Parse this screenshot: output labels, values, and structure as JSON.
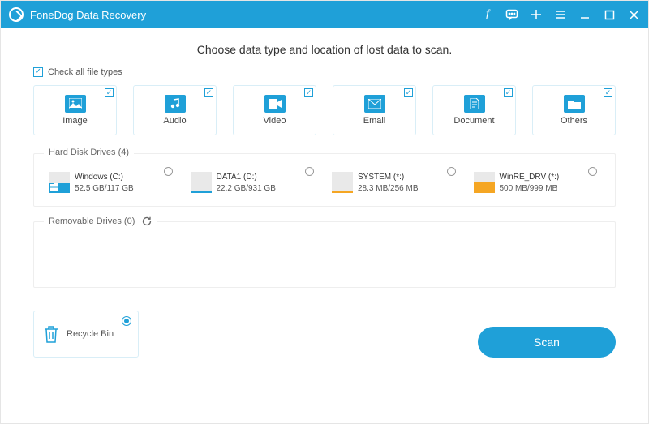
{
  "titlebar": {
    "title": "FoneDog Data Recovery"
  },
  "headline": "Choose data type and location of lost data to scan.",
  "check_all_label": "Check all file types",
  "types": [
    {
      "label": "Image"
    },
    {
      "label": "Audio"
    },
    {
      "label": "Video"
    },
    {
      "label": "Email"
    },
    {
      "label": "Document"
    },
    {
      "label": "Others"
    }
  ],
  "hdd_section": {
    "legend": "Hard Disk Drives (4)",
    "drives": [
      {
        "name": "Windows (C:)",
        "size": "52.5 GB/117 GB",
        "fill_pct": 45,
        "color": "#1fa0d8",
        "os": true
      },
      {
        "name": "DATA1 (D:)",
        "size": "22.2 GB/931 GB",
        "fill_pct": 6,
        "color": "#1fa0d8",
        "os": false
      },
      {
        "name": "SYSTEM (*:)",
        "size": "28.3 MB/256 MB",
        "fill_pct": 12,
        "color": "#f5a623",
        "os": false
      },
      {
        "name": "WinRE_DRV (*:)",
        "size": "500 MB/999 MB",
        "fill_pct": 50,
        "color": "#f5a623",
        "os": false
      }
    ]
  },
  "removable_section": {
    "legend": "Removable Drives (0)"
  },
  "recycle": {
    "label": "Recycle Bin"
  },
  "scan_button": "Scan"
}
